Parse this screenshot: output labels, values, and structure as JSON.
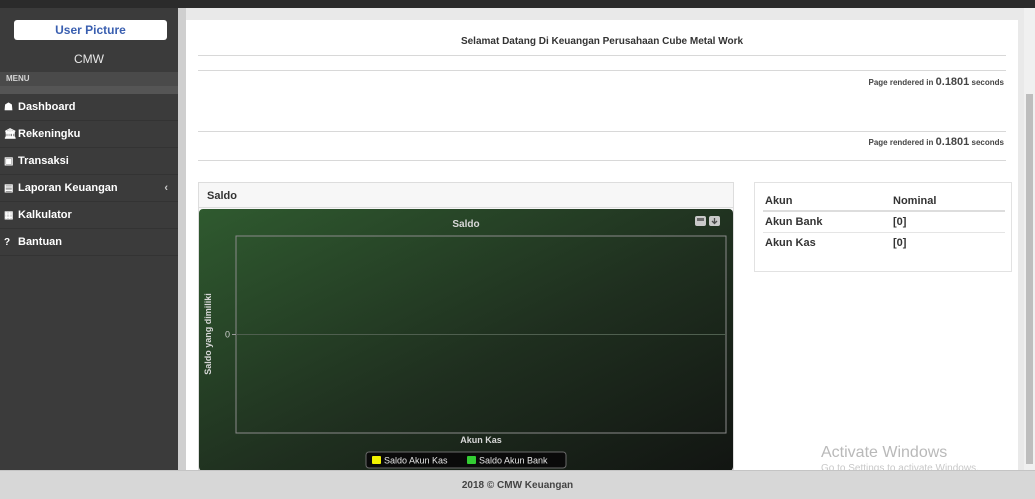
{
  "sidebar": {
    "user_picture": "User Picture",
    "brand": "CMW",
    "menu_header": "MENU",
    "items": [
      {
        "label": "Dashboard",
        "icon": "home-icon",
        "glyph": "☗"
      },
      {
        "label": "Rekeningku",
        "icon": "bank-icon",
        "glyph": "🏛"
      },
      {
        "label": "Transaksi",
        "icon": "money-icon",
        "glyph": "▣"
      },
      {
        "label": "Laporan Keuangan",
        "icon": "file-icon",
        "glyph": "▤",
        "chevron": "‹"
      },
      {
        "label": "Kalkulator",
        "icon": "calculator-icon",
        "glyph": "▦"
      },
      {
        "label": "Bantuan",
        "icon": "question-icon",
        "glyph": "?"
      }
    ]
  },
  "main": {
    "welcome": "Selamat Datang Di Keuangan Perusahaan Cube Metal Work",
    "render_prefix": "Page rendered in",
    "render_time": "0.1801",
    "render_suffix": "seconds"
  },
  "saldo_panel": {
    "title": "Saldo"
  },
  "akun_table": {
    "headers": [
      "Akun",
      "Nominal"
    ],
    "rows": [
      [
        "Akun Bank",
        "[0]"
      ],
      [
        "Akun Kas",
        "[0]"
      ]
    ]
  },
  "chart_data": {
    "type": "bar",
    "title": "Saldo",
    "xlabel": "",
    "ylabel": "Saldo yang dimiliki",
    "categories": [
      "Akun Kas"
    ],
    "series": [
      {
        "name": "Saldo Akun Kas",
        "values": [
          0
        ],
        "color": "#f2f200"
      },
      {
        "name": "Saldo Akun Bank",
        "values": [
          0
        ],
        "color": "#33cc33"
      }
    ],
    "y_ticks": [
      "0"
    ],
    "legend": "bottom-center",
    "grid": true
  },
  "watermark": {
    "line1": "Activate Windows",
    "line2": "Go to Settings to activate Windows."
  },
  "footer": "2018 © CMW Keuangan"
}
